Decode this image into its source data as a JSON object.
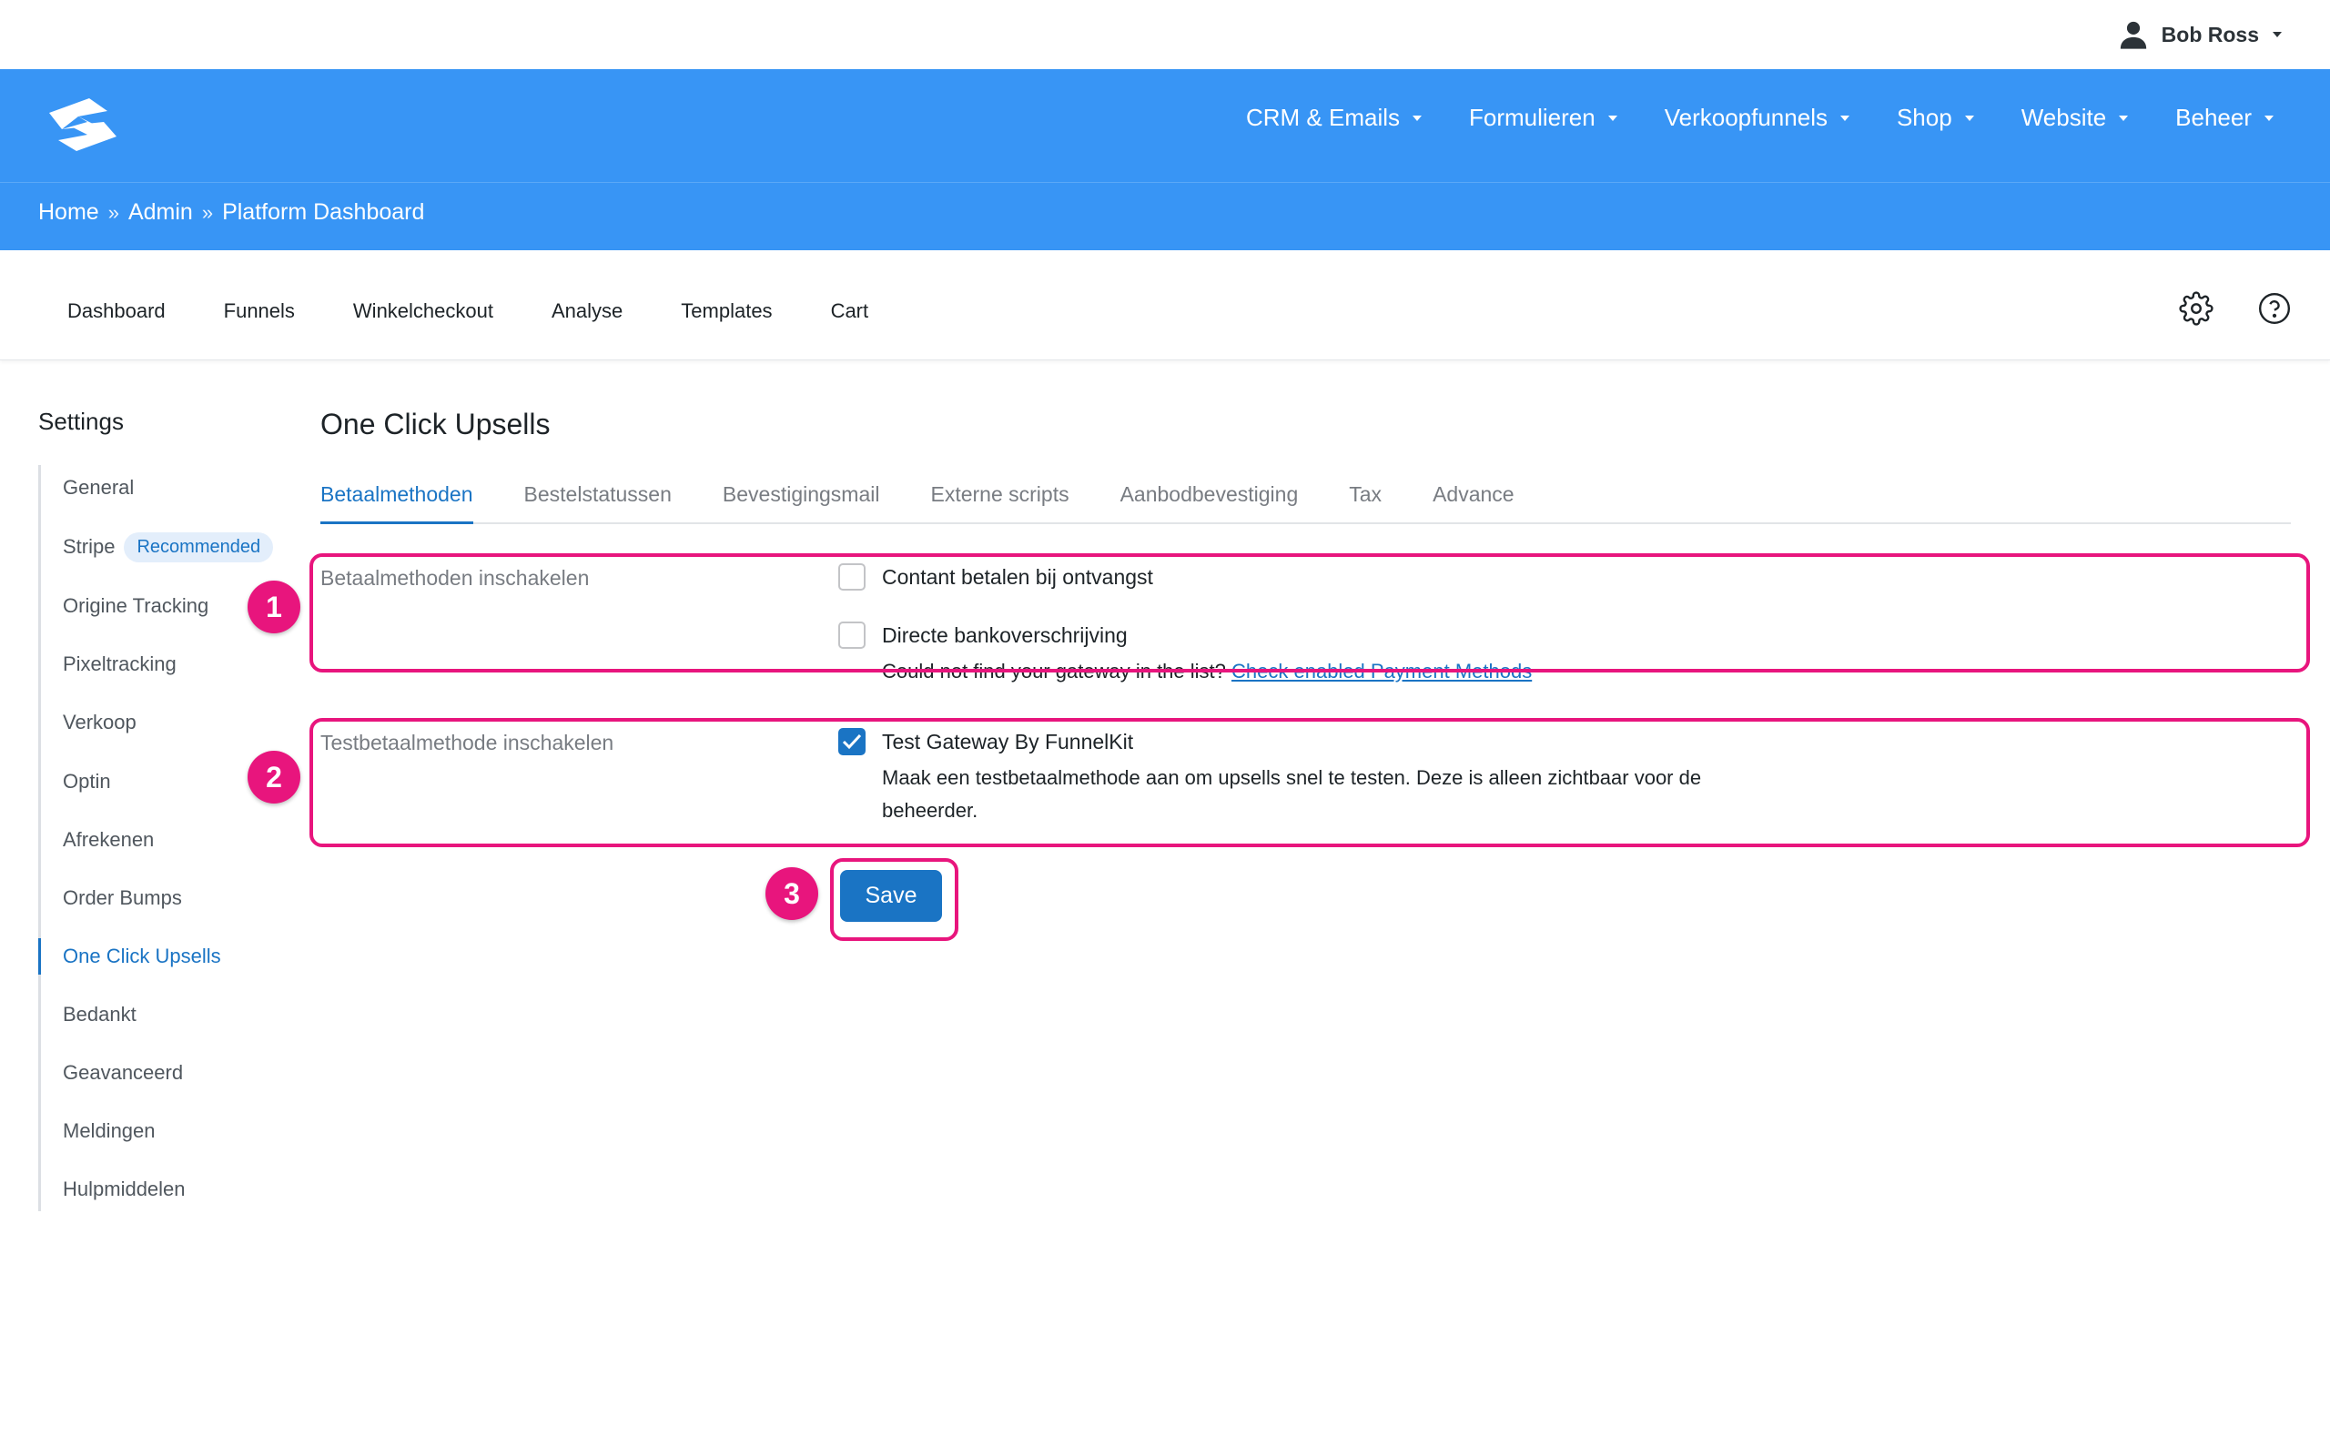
{
  "user": {
    "name": "Bob Ross",
    "icon": "user-icon"
  },
  "header": {
    "logo": "funnelkit-logo",
    "nav": [
      {
        "label": "CRM & Emails"
      },
      {
        "label": "Formulieren"
      },
      {
        "label": "Verkoopfunnels"
      },
      {
        "label": "Shop"
      },
      {
        "label": "Website"
      },
      {
        "label": "Beheer"
      }
    ]
  },
  "breadcrumb": {
    "items": [
      "Home",
      "Admin",
      "Platform Dashboard"
    ],
    "separator": "»"
  },
  "subnav": {
    "tabs": [
      "Dashboard",
      "Funnels",
      "Winkelcheckout",
      "Analyse",
      "Templates",
      "Cart"
    ],
    "icons": [
      "gear-icon",
      "help-icon"
    ]
  },
  "sidebar": {
    "title": "Settings",
    "items": [
      {
        "label": "General"
      },
      {
        "label": "Stripe",
        "badge": "Recommended"
      },
      {
        "label": "Origine Tracking"
      },
      {
        "label": "Pixeltracking"
      },
      {
        "label": "Verkoop"
      },
      {
        "label": "Optin"
      },
      {
        "label": "Afrekenen"
      },
      {
        "label": "Order Bumps"
      },
      {
        "label": "One Click Upsells",
        "active": true
      },
      {
        "label": "Bedankt"
      },
      {
        "label": "Geavanceerd"
      },
      {
        "label": "Meldingen"
      },
      {
        "label": "Hulpmiddelen"
      }
    ]
  },
  "main": {
    "title": "One Click Upsells",
    "tabs": [
      {
        "label": "Betaalmethoden",
        "active": true
      },
      {
        "label": "Bestelstatussen"
      },
      {
        "label": "Bevestigingsmail"
      },
      {
        "label": "Externe scripts"
      },
      {
        "label": "Aanbodbevestiging"
      },
      {
        "label": "Tax"
      },
      {
        "label": "Advance"
      }
    ],
    "payment_section": {
      "label": "Betaalmethoden inschakelen",
      "options": [
        {
          "label": "Contant betalen bij ontvangst",
          "checked": false
        },
        {
          "label": "Directe bankoverschrijving",
          "checked": false
        }
      ],
      "help_prefix": "Could not find your gateway in the list?",
      "help_link": "Check enabled Payment Methods"
    },
    "test_section": {
      "label": "Testbetaalmethode inschakelen",
      "option": {
        "label": "Test Gateway By FunnelKit",
        "checked": true
      },
      "help_line1": "Maak een testbetaalmethode aan om upsells snel te testen. Deze is alleen zichtbaar voor de",
      "help_line2": "beheerder."
    },
    "save_label": "Save"
  },
  "annotations": {
    "markers": [
      "1",
      "2",
      "3"
    ],
    "color": "#e8157d"
  },
  "colors": {
    "header": "#3895f5",
    "accent": "#1a74c4"
  }
}
